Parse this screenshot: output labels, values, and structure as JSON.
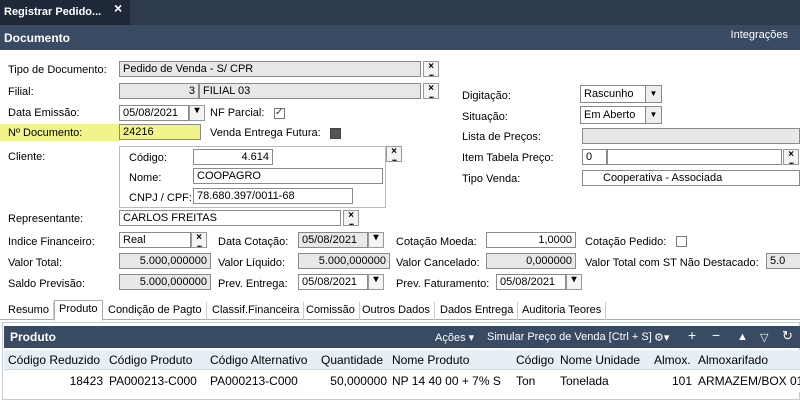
{
  "app": {
    "tab_title": "Registrar Pedido...",
    "close": "×"
  },
  "header": {
    "title": "Documento",
    "integracoes": "Integrações"
  },
  "form": {
    "tipo_doc_label": "Tipo de Documento:",
    "tipo_doc_value": "Pedido de Venda - S/ CPR",
    "filial_label": "Filial:",
    "filial_code": "3",
    "filial_name": "FILIAL 03",
    "data_emissao_label": "Data Emissão:",
    "data_emissao_value": "05/08/2021",
    "nf_parcial_label": "NF Parcial:",
    "n_documento_label": "Nº Documento:",
    "n_documento_value": "24216",
    "venda_entrega_futura_label": "Venda Entrega Futura:",
    "cliente_label": "Cliente:",
    "codigo_label": "Código:",
    "codigo_value": "4.614",
    "nome_label": "Nome:",
    "nome_value": "COOPAGRO",
    "cnpj_label": "CNPJ / CPF:",
    "cnpj_value": "78.680.397/0011-68",
    "digitacao_label": "Digitação:",
    "digitacao_value": "Rascunho",
    "situacao_label": "Situação:",
    "situacao_value": "Em Aberto",
    "lista_precos_label": "Lista de Preços:",
    "lista_precos_value": "",
    "item_tabela_label": "Item Tabela Preço:",
    "item_tabela_value": "0",
    "tipo_venda_label": "Tipo Venda:",
    "tipo_venda_value": "Cooperativa - Associada",
    "representante_label": "Representante:",
    "representante_value": "CARLOS FREITAS",
    "indice_label": "Indice Financeiro:",
    "indice_value": "Real",
    "data_cotacao_label": "Data Cotação:",
    "data_cotacao_value": "05/08/2021",
    "cotacao_moeda_label": "Cotação Moeda:",
    "cotacao_moeda_value": "1,0000",
    "cotacao_pedido_label": "Cotação Pedido:",
    "valor_total_label": "Valor Total:",
    "valor_total_value": "5.000,000000",
    "valor_liquido_label": "Valor Líquido:",
    "valor_liquido_value": "5.000,000000",
    "valor_cancelado_label": "Valor Cancelado:",
    "valor_cancelado_value": "0,000000",
    "valor_st_label": "Valor Total com ST Não Destacado:",
    "valor_st_value": "5.0",
    "saldo_label": "Saldo Previsão:",
    "saldo_value": "5.000,000000",
    "prev_entrega_label": "Prev. Entrega:",
    "prev_entrega_value": "05/08/2021",
    "prev_faturamento_label": "Prev. Faturamento:",
    "prev_faturamento_value": "05/08/2021"
  },
  "tabs": [
    "Resumo",
    "Produto",
    "Condição de Pagto",
    "Classif.Financeira",
    "Comissão",
    "Outros Dados",
    "Dados Entrega",
    "Auditoria Teores"
  ],
  "produto": {
    "title": "Produto",
    "acoes": "Ações ▾",
    "simular": "Simular Preço de Venda [Ctrl + S]",
    "columns": [
      "Código Reduzido",
      "Código Produto",
      "Código Alternativo",
      "Quantidade",
      "Nome Produto",
      "Código",
      "Nome Unidade",
      "Almox.",
      "Almoxarifado"
    ],
    "rows": [
      [
        "18423",
        "PA000213-C000",
        "PA000213-C000",
        "50,000000",
        "NP 14 40 00 + 7% S",
        "Ton",
        "Tonelada",
        "101",
        "ARMAZEM/BOX 01"
      ]
    ]
  }
}
